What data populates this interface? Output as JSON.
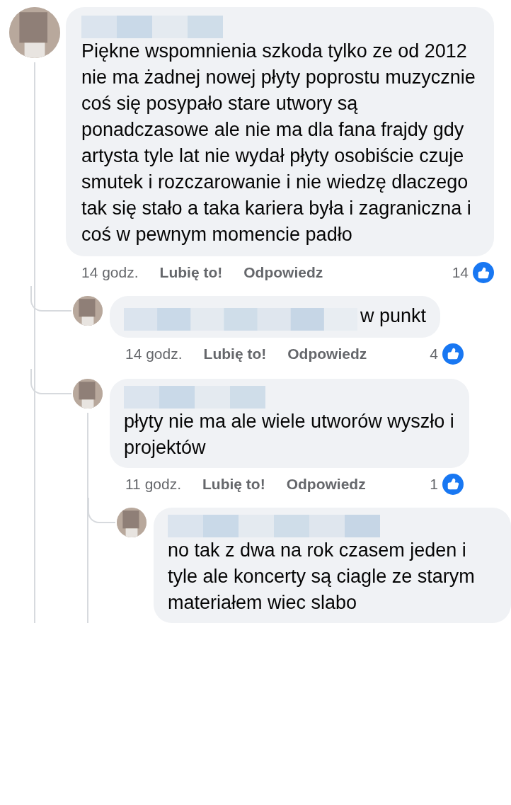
{
  "comments": [
    {
      "text": "Piękne wspomnienia szkoda tylko ze od 2012 nie ma żadnej nowej płyty poprostu muzycznie coś się posypało stare utwory są ponadczasowe ale nie ma dla fana frajdy gdy artysta tyle lat nie wydał płyty osobiście czuje smutek i rozczarowanie i nie wiedzę dlaczego tak się stało a taka kariera była i zagraniczna i coś w pewnym momencie padło",
      "meta": {
        "time": "14 godz.",
        "like": "Lubię to!",
        "reply": "Odpowiedz",
        "reactions": "14"
      },
      "children": [
        {
          "text": "w punkt",
          "meta": {
            "time": "14 godz.",
            "like": "Lubię to!",
            "reply": "Odpowiedz",
            "reactions": "4"
          }
        },
        {
          "text": "płyty nie ma ale wiele utworów wyszło i projektów",
          "meta": {
            "time": "11 godz.",
            "like": "Lubię to!",
            "reply": "Odpowiedz",
            "reactions": "1"
          },
          "children": [
            {
              "text": "no tak z dwa na rok czasem jeden i tyle ale koncerty są ciagle ze starym materiałem wiec slabo"
            }
          ]
        }
      ]
    }
  ]
}
